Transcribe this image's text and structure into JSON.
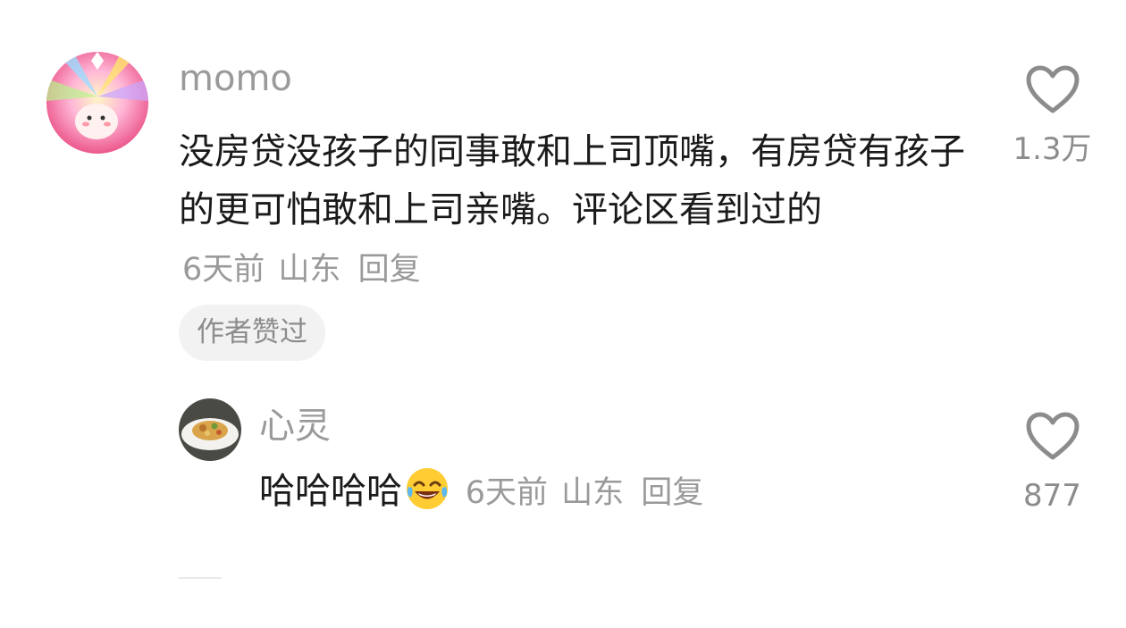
{
  "comments": [
    {
      "username": "momo",
      "text": "没房贷没孩子的同事敢和上司顶嘴，有房贷有孩子的更可怕敢和上司亲嘴。评论区看到过的",
      "time": "6天前",
      "location": "山东",
      "reply_label": "回复",
      "tag": "作者赞过",
      "like_count": "1.3万"
    }
  ],
  "replies": [
    {
      "username": "心灵",
      "text": "哈哈哈哈",
      "emoji": "joy-emoji",
      "time": "6天前",
      "location": "山东",
      "reply_label": "回复",
      "like_count": "877"
    }
  ],
  "icons": {
    "like": "heart-outline-icon"
  },
  "colors": {
    "text": "#1a1a1a",
    "meta": "#9a9a9a",
    "tag_bg": "#f2f2f2"
  }
}
